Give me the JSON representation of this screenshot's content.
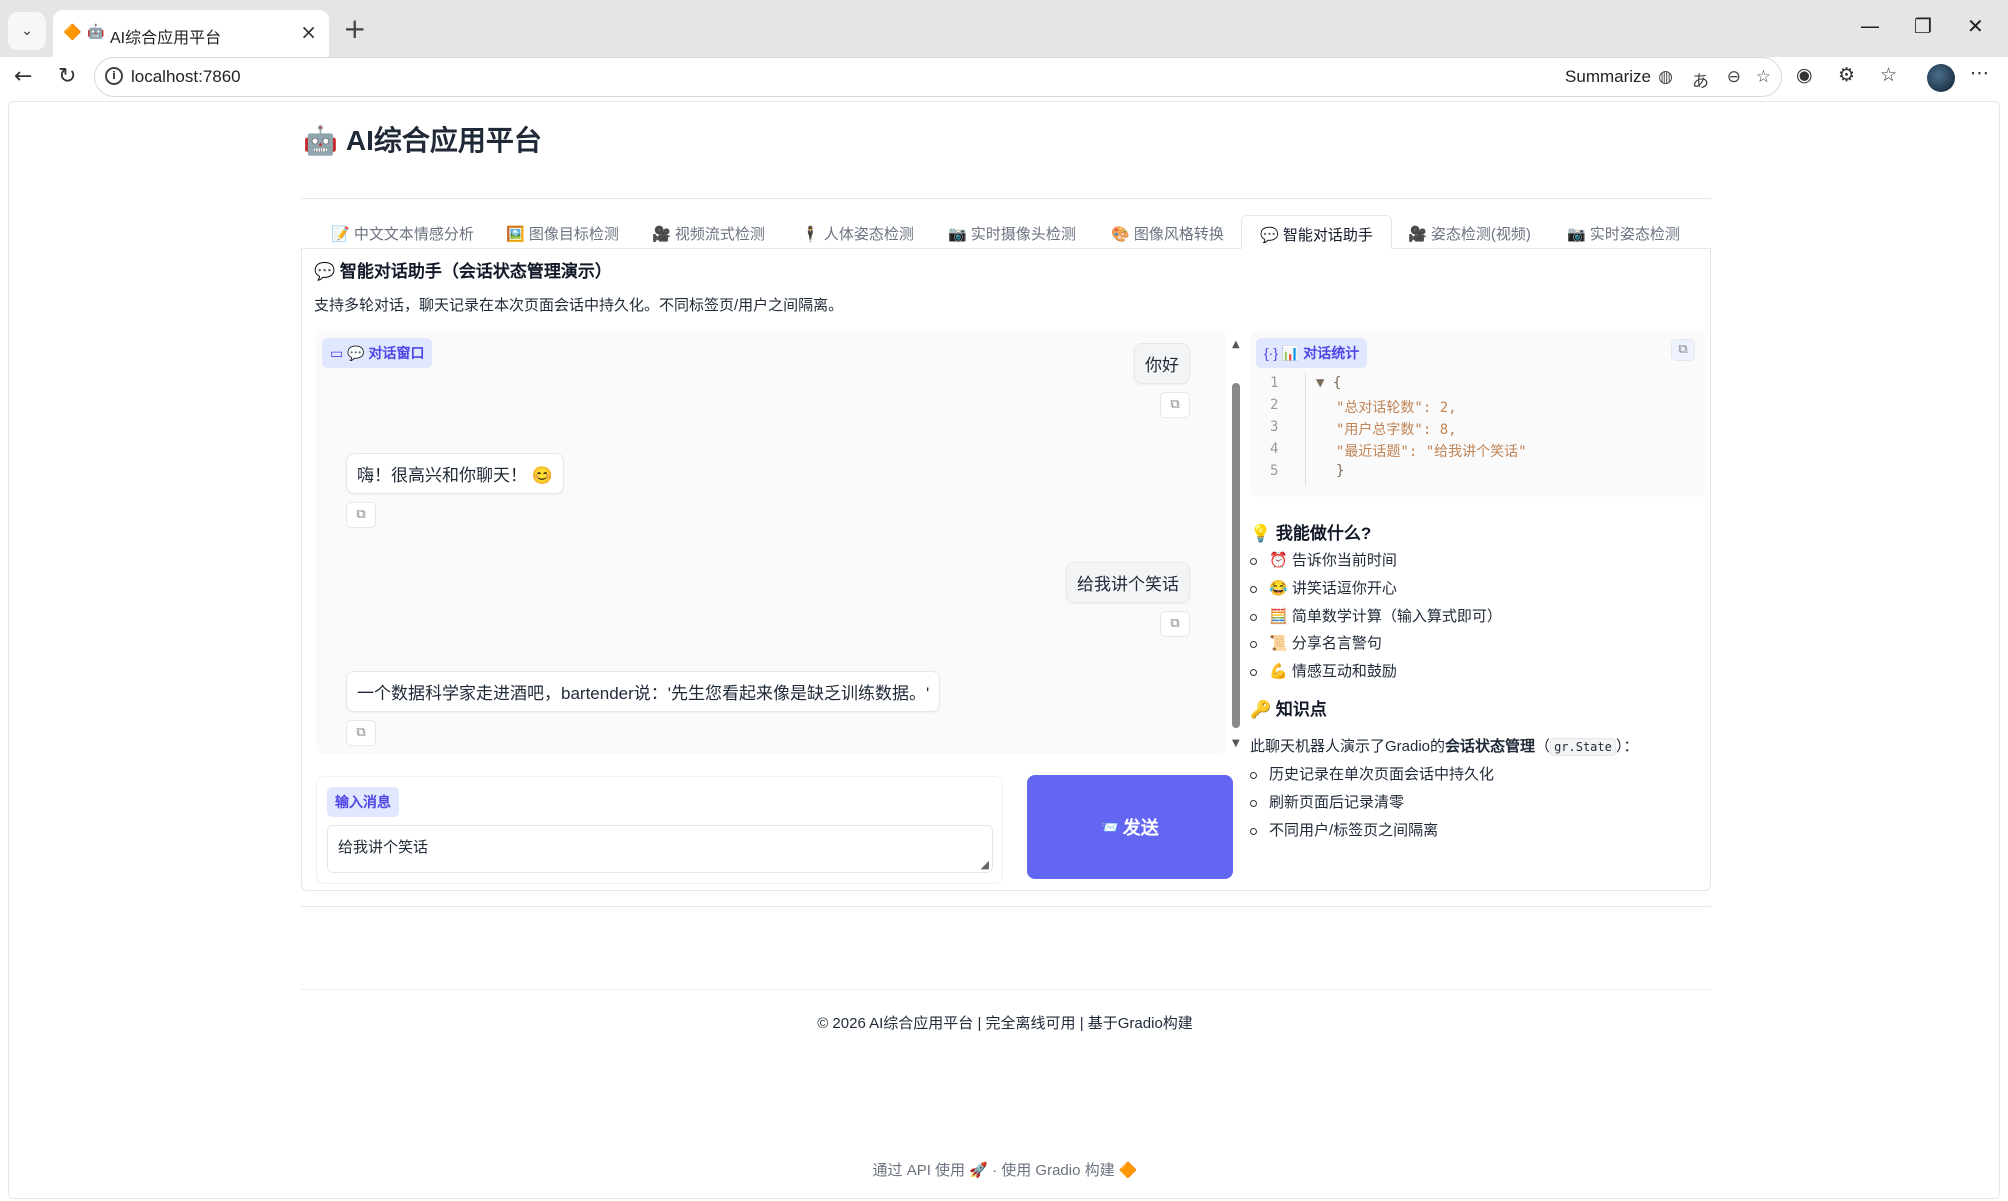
{
  "browser": {
    "tab_title": "AI综合应用平台",
    "url": "localhost:7860",
    "summarize_label": "Summarize"
  },
  "app": {
    "title": "AI综合应用平台",
    "title_icon": "robot-icon"
  },
  "tabs": [
    {
      "label": "中文文本情感分析",
      "icon": "📝"
    },
    {
      "label": "图像目标检测",
      "icon": "🖼️"
    },
    {
      "label": "视频流式检测",
      "icon": "🎥"
    },
    {
      "label": "人体姿态检测",
      "icon": "🕴️"
    },
    {
      "label": "实时摄像头检测",
      "icon": "📷"
    },
    {
      "label": "图像风格转换",
      "icon": "🎨"
    },
    {
      "label": "智能对话助手",
      "icon": "💬",
      "active": true
    },
    {
      "label": "姿态检测(视频)",
      "icon": "🎥"
    },
    {
      "label": "实时姿态检测",
      "icon": "📷"
    }
  ],
  "section": {
    "title": "智能对话助手（会话状态管理演示）",
    "description": "支持多轮对话，聊天记录在本次页面会话中持久化。不同标签页/用户之间隔离。"
  },
  "chat": {
    "label": "💬 对话窗口",
    "messages": [
      {
        "role": "user",
        "text": "你好"
      },
      {
        "role": "bot",
        "text": "嗨！很高兴和你聊天！ 😊"
      },
      {
        "role": "user",
        "text": "给我讲个笑话"
      },
      {
        "role": "bot",
        "text": "一个数据科学家走进酒吧，bartender说：'先生您看起来像是缺乏训练数据。'"
      }
    ]
  },
  "input": {
    "label": "输入消息",
    "value": "给我讲个笑话"
  },
  "send_button": {
    "label": "发送",
    "icon": "📨"
  },
  "stats": {
    "label": "📊 对话统计",
    "lines": [
      {
        "n": "1",
        "text": "▼ {"
      },
      {
        "n": "2",
        "text": "\"总对话轮数\": 2,"
      },
      {
        "n": "3",
        "text": "\"用户总字数\": 8,"
      },
      {
        "n": "4",
        "text": "\"最近话题\": \"给我讲个笑话\""
      },
      {
        "n": "5",
        "text": "}"
      }
    ]
  },
  "capabilities": {
    "title": "💡 我能做什么?",
    "items": [
      "⏰ 告诉你当前时间",
      "😂 讲笑话逗你开心",
      "🧮 简单数学计算（输入算式即可）",
      "📜 分享名言警句",
      "💪 情感互动和鼓励"
    ]
  },
  "knowledge": {
    "title": "🔑 知识点",
    "intro_prefix": "此聊天机器人演示了Gradio的",
    "intro_bold": "会话状态管理",
    "intro_code": "gr.State",
    "items": [
      "历史记录在单次页面会话中持久化",
      "刷新页面后记录清零",
      "不同用户/标签页之间隔离"
    ]
  },
  "footer": {
    "text": "© 2026 AI综合应用平台 | 完全离线可用 | 基于Gradio构建"
  },
  "gradio_footer": {
    "api_text": "通过 API 使用",
    "built_text": "使用 Gradio 构建"
  }
}
